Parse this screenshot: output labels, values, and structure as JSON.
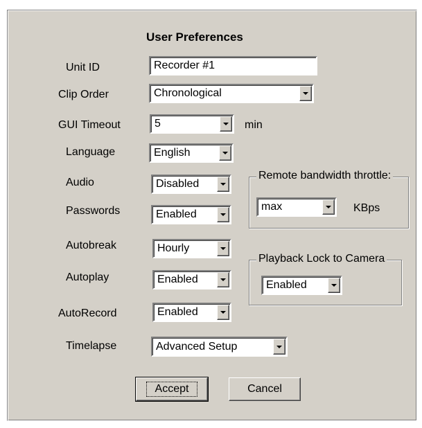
{
  "title": "User Preferences",
  "fields": {
    "unit_id": {
      "label": "Unit ID",
      "value": "Recorder #1"
    },
    "clip_order": {
      "label": "Clip Order",
      "value": "Chronological"
    },
    "gui_timeout": {
      "label": "GUI Timeout",
      "value": "5",
      "unit": "min"
    },
    "language": {
      "label": "Language",
      "value": "English"
    },
    "audio": {
      "label": "Audio",
      "value": "Disabled"
    },
    "passwords": {
      "label": "Passwords",
      "value": "Enabled"
    },
    "autobreak": {
      "label": "Autobreak",
      "value": "Hourly"
    },
    "autoplay": {
      "label": "Autoplay",
      "value": "Enabled"
    },
    "autorecord": {
      "label": "AutoRecord",
      "value": "Enabled"
    },
    "timelapse": {
      "label": "Timelapse",
      "value": "Advanced Setup"
    }
  },
  "bandwidth_group": {
    "label": "Remote bandwidth throttle:",
    "value": "max",
    "unit": "KBps"
  },
  "playback_group": {
    "label": "Playback Lock to Camera",
    "value": "Enabled"
  },
  "buttons": {
    "accept": "Accept",
    "cancel": "Cancel"
  },
  "icons": {
    "dropdown": "chevron-down-icon"
  },
  "colors": {
    "panel": "#d4d0c8",
    "field": "#ffffff"
  }
}
